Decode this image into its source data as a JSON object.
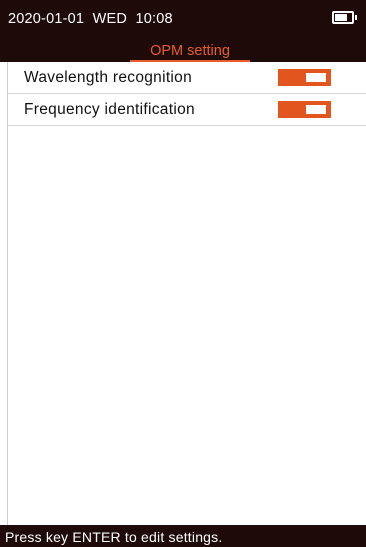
{
  "status_bar": {
    "datetime": "2020-01-01  WED  10:08",
    "battery_icon": "battery-icon"
  },
  "header": {
    "tab_label": "OPM setting"
  },
  "settings": [
    {
      "label": "Wavelength recognition",
      "enabled": true
    },
    {
      "label": "Frequency identification",
      "enabled": true
    }
  ],
  "footer": {
    "hint": "Press key ENTER to edit settings."
  },
  "colors": {
    "accent": "#e95d2c",
    "toggle_on": "#e2551f",
    "bar_background": "#1f0a0a"
  }
}
